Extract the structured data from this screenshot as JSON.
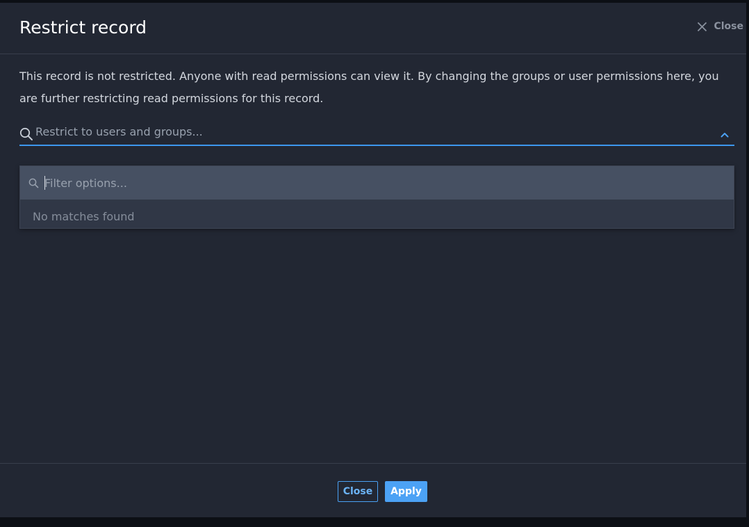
{
  "dialog": {
    "title": "Restrict record",
    "header_close_label": "Close",
    "description": "This record is not restricted. Anyone with read permissions can view it. By changing the groups or user permissions here, you are further restricting read permissions for this record."
  },
  "restrict_select": {
    "placeholder": "Restrict to users and groups...",
    "expanded": true
  },
  "dropdown": {
    "filter_placeholder": "Filter options...",
    "filter_value": "",
    "empty_message": "No matches found"
  },
  "footer": {
    "close_label": "Close",
    "apply_label": "Apply"
  },
  "icons": {
    "header_close": "close-icon",
    "select_search": "search-icon",
    "select_toggle": "chevron-up-icon",
    "filter_search": "search-icon"
  },
  "colors": {
    "background": "#222733",
    "accent": "#4ca2f5",
    "text": "#d3d7de",
    "muted": "#98a1ae",
    "dropdown_filter_bg": "#465062"
  }
}
